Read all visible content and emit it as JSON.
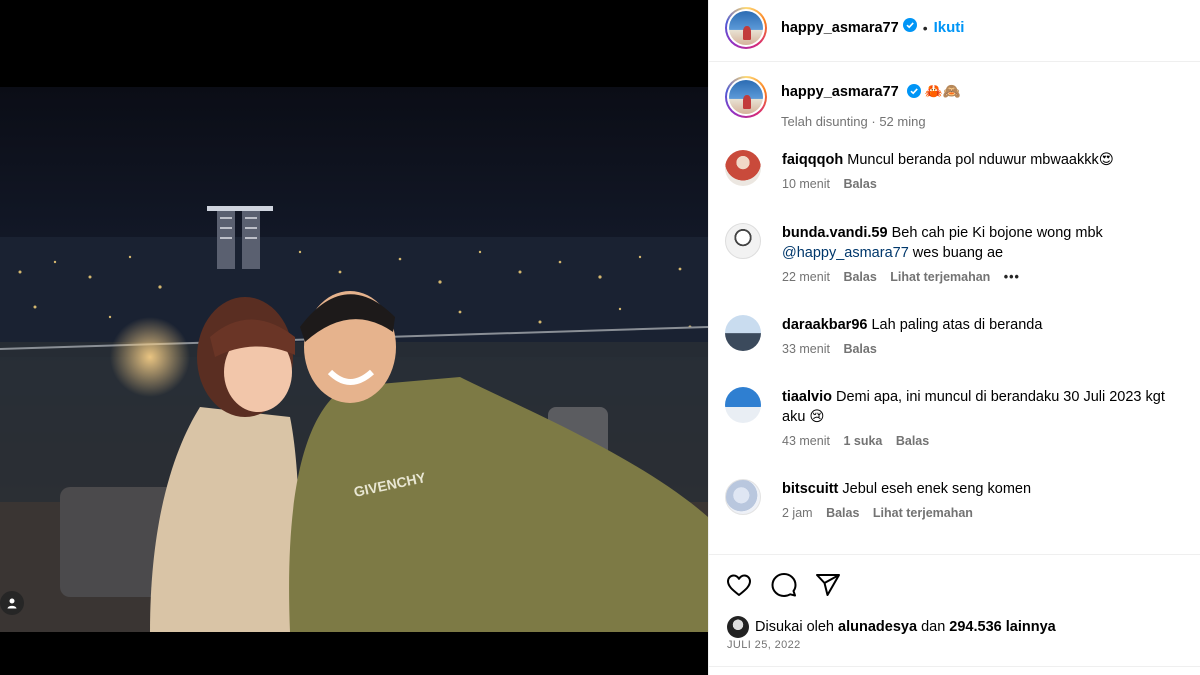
{
  "header": {
    "username": "happy_asmara77",
    "separator": "•",
    "follow_label": "Ikuti"
  },
  "caption": {
    "username": "happy_asmara77",
    "text": "🦀🙈",
    "edited_label": "Telah disunting",
    "time": "52 ming"
  },
  "comments": [
    {
      "user": "faiqqqoh",
      "text": "Muncul beranda pol nduwur mbwaakkk😍",
      "time": "10 menit",
      "likes": "",
      "reply": "Balas",
      "translate": "",
      "more": ""
    },
    {
      "user": "bunda.vandi.59",
      "text": "Beh cah pie Ki bojone wong mbk",
      "mention": "@happy_asmara77",
      "text2": " wes buang ae",
      "time": "22 menit",
      "likes": "",
      "reply": "Balas",
      "translate": "Lihat terjemahan",
      "more": "•••"
    },
    {
      "user": "daraakbar96",
      "text": "Lah paling atas di beranda",
      "time": "33 menit",
      "likes": "",
      "reply": "Balas",
      "translate": "",
      "more": ""
    },
    {
      "user": "tiaalvio",
      "text": "Demi apa, ini muncul di berandaku 30 Juli 2023 kgt",
      "text2": "aku 😢",
      "time": "43 menit",
      "likes": "1 suka",
      "reply": "Balas",
      "translate": "",
      "more": ""
    },
    {
      "user": "bitscuitt",
      "text": "Jebul eseh enek seng komen",
      "time": "2 jam",
      "likes": "",
      "reply": "Balas",
      "translate": "Lihat terjemahan",
      "more": ""
    }
  ],
  "likes": {
    "prefix": "Disukai oleh",
    "user": "alunadesya",
    "middle": "dan",
    "count": "294.536 lainnya"
  },
  "date": "JULI 25, 2022",
  "colors": {
    "link": "#0095f6",
    "secondary": "#737373",
    "mention": "#00376b"
  }
}
